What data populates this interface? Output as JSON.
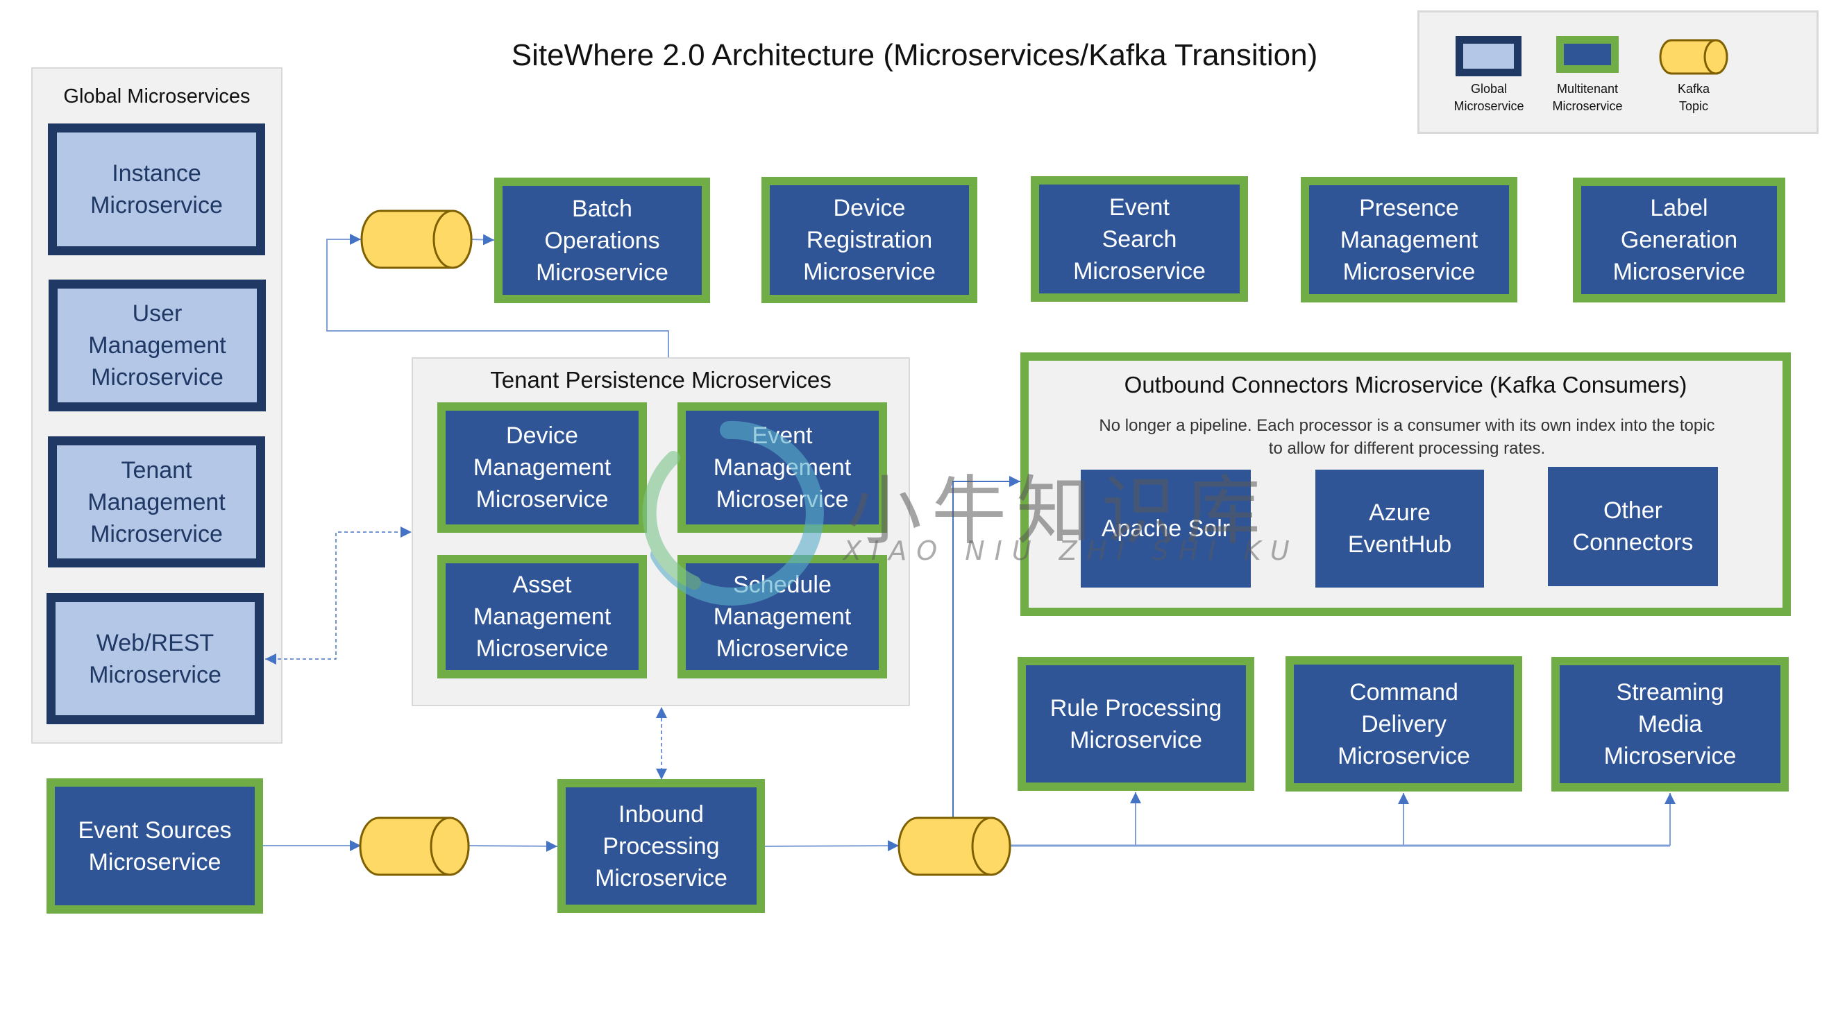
{
  "title": "SiteWhere 2.0 Architecture (Microservices/Kafka Transition)",
  "legend": {
    "items": [
      {
        "label": "Global\nMicroservice",
        "shape": "global-box"
      },
      {
        "label": "Multitenant\nMicroservice",
        "shape": "multitenant-box"
      },
      {
        "label": "Kafka\nTopic",
        "shape": "kafka-cylinder"
      }
    ]
  },
  "global_panel": {
    "title": "Global Microservices",
    "items": [
      {
        "label": "Instance\nMicroservice"
      },
      {
        "label": "User\nManagement\nMicroservice"
      },
      {
        "label": "Tenant\nManagement\nMicroservice"
      },
      {
        "label": "Web/REST\nMicroservice"
      }
    ]
  },
  "top_row": [
    {
      "label": "Batch\nOperations\nMicroservice"
    },
    {
      "label": "Device\nRegistration\nMicroservice"
    },
    {
      "label": "Event\nSearch\nMicroservice"
    },
    {
      "label": "Presence\nManagement\nMicroservice"
    },
    {
      "label": "Label\nGeneration\nMicroservice"
    }
  ],
  "tenant_persistence": {
    "title": "Tenant Persistence Microservices",
    "items": [
      {
        "label": "Device\nManagement\nMicroservice"
      },
      {
        "label": "Event\nManagement\nMicroservice"
      },
      {
        "label": "Asset\nManagement\nMicroservice"
      },
      {
        "label": "Schedule\nManagement\nMicroservice"
      }
    ]
  },
  "outbound": {
    "title": "Outbound Connectors Microservice (Kafka Consumers)",
    "description": "No longer a pipeline. Each processor is a consumer with its own index into the topic to allow for different processing rates.",
    "connectors": [
      {
        "label": "Apache Solr"
      },
      {
        "label": "Azure\nEventHub"
      },
      {
        "label": "Other\nConnectors"
      }
    ]
  },
  "bottom_right": [
    {
      "label": "Rule Processing\nMicroservice"
    },
    {
      "label": "Command\nDelivery\nMicroservice"
    },
    {
      "label": "Streaming\nMedia\nMicroservice"
    }
  ],
  "event_sources": {
    "label": "Event Sources\nMicroservice"
  },
  "inbound": {
    "label": "Inbound\nProcessing\nMicroservice"
  },
  "watermark": {
    "text_cn": "小牛知识库",
    "text_en": "XIAO NIU ZHI SHI KU"
  },
  "colors": {
    "global_fill": "#b4c7e7",
    "global_border": "#1f3864",
    "multitenant_fill": "#2f5597",
    "multitenant_border": "#70ad47",
    "kafka_fill": "#ffd966",
    "kafka_stroke": "#7f6000",
    "connector_line": "#4472c4",
    "panel_fill": "#f1f1f1"
  }
}
